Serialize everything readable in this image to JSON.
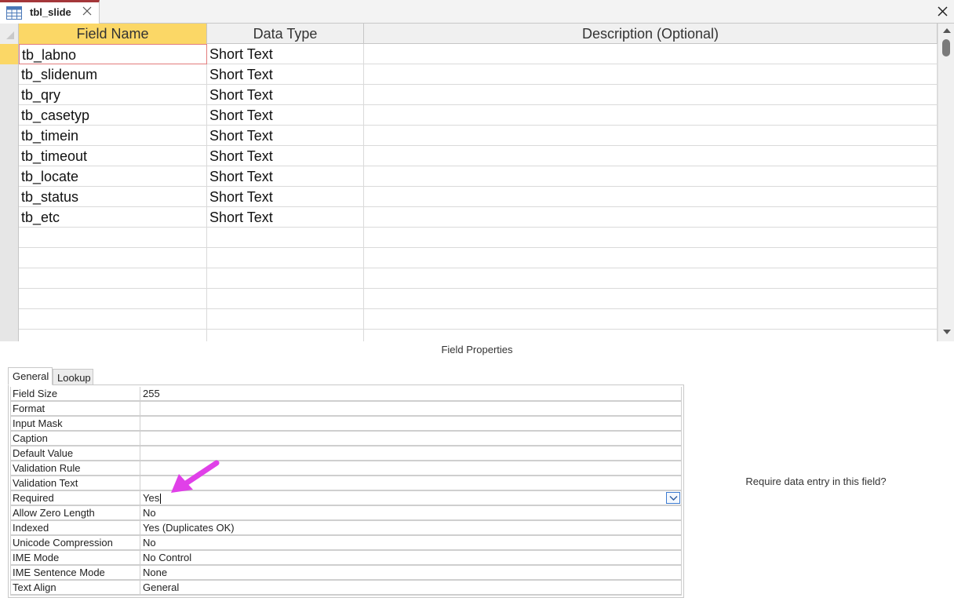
{
  "tab": {
    "title": "tbl_slide",
    "icon": "table-icon"
  },
  "grid": {
    "headers": {
      "field_name": "Field Name",
      "data_type": "Data Type",
      "description": "Description (Optional)"
    },
    "rows": [
      {
        "field": "tb_labno",
        "type": "Short Text",
        "description": ""
      },
      {
        "field": "tb_slidenum",
        "type": "Short Text",
        "description": ""
      },
      {
        "field": "tb_qry",
        "type": "Short Text",
        "description": ""
      },
      {
        "field": "tb_casetyp",
        "type": "Short Text",
        "description": ""
      },
      {
        "field": "tb_timein",
        "type": "Short Text",
        "description": ""
      },
      {
        "field": "tb_timeout",
        "type": "Short Text",
        "description": ""
      },
      {
        "field": "tb_locate",
        "type": "Short Text",
        "description": ""
      },
      {
        "field": "tb_status",
        "type": "Short Text",
        "description": ""
      },
      {
        "field": "tb_etc",
        "type": "Short Text",
        "description": ""
      },
      {
        "field": "",
        "type": "",
        "description": ""
      },
      {
        "field": "",
        "type": "",
        "description": ""
      },
      {
        "field": "",
        "type": "",
        "description": ""
      },
      {
        "field": "",
        "type": "",
        "description": ""
      },
      {
        "field": "",
        "type": "",
        "description": ""
      },
      {
        "field": "",
        "type": "",
        "description": ""
      }
    ]
  },
  "field_properties": {
    "title": "Field Properties",
    "tabs": [
      "General",
      "Lookup"
    ],
    "rows": [
      {
        "label": "Field Size",
        "value": "255"
      },
      {
        "label": "Format",
        "value": ""
      },
      {
        "label": "Input Mask",
        "value": ""
      },
      {
        "label": "Caption",
        "value": ""
      },
      {
        "label": "Default Value",
        "value": ""
      },
      {
        "label": "Validation Rule",
        "value": ""
      },
      {
        "label": "Validation Text",
        "value": ""
      },
      {
        "label": "Required",
        "value": "Yes"
      },
      {
        "label": "Allow Zero Length",
        "value": "No"
      },
      {
        "label": "Indexed",
        "value": "Yes (Duplicates OK)"
      },
      {
        "label": "Unicode Compression",
        "value": "No"
      },
      {
        "label": "IME Mode",
        "value": "No Control"
      },
      {
        "label": "IME Sentence Mode",
        "value": "None"
      },
      {
        "label": "Text Align",
        "value": "General"
      }
    ],
    "help_text": "Require data entry in this field?"
  },
  "colors": {
    "header_highlight": "#fbd766",
    "tab_accent": "#a4373a",
    "annotation_arrow": "#e040e8"
  }
}
